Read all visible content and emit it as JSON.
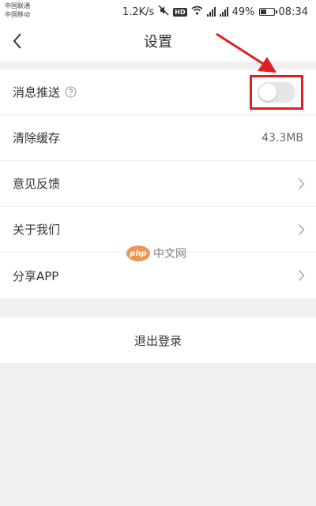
{
  "status_bar": {
    "carrier_1": "中国联通",
    "carrier_2": "中国移动",
    "net_speed": "1.2K/s",
    "hd_badge": "HD",
    "battery_percent": "49%",
    "battery_level": 0.49,
    "time": "08:34",
    "icons": [
      "mute-icon",
      "wifi-icon",
      "signal-icon",
      "battery-icon"
    ]
  },
  "header": {
    "title": "设置",
    "back_icon": "chevron-left-icon"
  },
  "settings": {
    "push": {
      "label": "消息推送",
      "enabled": false,
      "highlight_color": "#e02020"
    },
    "cache": {
      "label": "清除缓存",
      "value": "43.3MB"
    },
    "feedback": {
      "label": "意见反馈"
    },
    "about": {
      "label": "关于我们"
    },
    "share": {
      "label": "分享APP"
    }
  },
  "logout": {
    "label": "退出登录"
  },
  "watermark": {
    "logo_text": "php",
    "text": "中文网"
  },
  "colors": {
    "annotation": "#e02020",
    "background": "#f0f0f0",
    "card": "#ffffff"
  }
}
